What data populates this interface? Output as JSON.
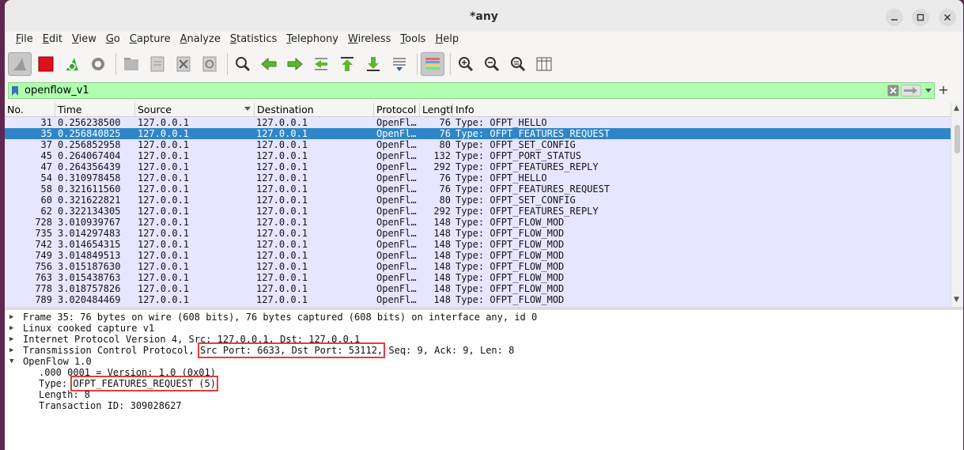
{
  "window": {
    "title": "*any"
  },
  "menu": [
    "File",
    "Edit",
    "View",
    "Go",
    "Capture",
    "Analyze",
    "Statistics",
    "Telephony",
    "Wireless",
    "Tools",
    "Help"
  ],
  "toolbar": {
    "icons": [
      "shark-fin-start-icon",
      "stop-capture-icon",
      "restart-capture-icon",
      "capture-options-icon",
      "open-file-icon",
      "save-file-icon",
      "close-file-icon",
      "reload-file-icon",
      "find-packet-icon",
      "go-back-icon",
      "go-forward-icon",
      "go-to-packet-icon",
      "first-packet-icon",
      "last-packet-icon",
      "auto-scroll-icon",
      "colorize-icon",
      "zoom-in-icon",
      "zoom-out-icon",
      "normal-size-icon",
      "resize-columns-icon"
    ]
  },
  "filter": {
    "value": "openflow_v1"
  },
  "columns": [
    "No.",
    "Time",
    "Source",
    "Destination",
    "Protocol",
    "Length",
    "Info"
  ],
  "packets": [
    {
      "no": "31",
      "time": "0.256238500",
      "src": "127.0.0.1",
      "dst": "127.0.0.1",
      "proto": "OpenFl…",
      "len": "76",
      "info": "Type: OFPT_HELLO"
    },
    {
      "no": "35",
      "time": "0.256840825",
      "src": "127.0.0.1",
      "dst": "127.0.0.1",
      "proto": "OpenFl…",
      "len": "76",
      "info": "Type: OFPT_FEATURES_REQUEST",
      "selected": true
    },
    {
      "no": "37",
      "time": "0.256852958",
      "src": "127.0.0.1",
      "dst": "127.0.0.1",
      "proto": "OpenFl…",
      "len": "80",
      "info": "Type: OFPT_SET_CONFIG"
    },
    {
      "no": "45",
      "time": "0.264067404",
      "src": "127.0.0.1",
      "dst": "127.0.0.1",
      "proto": "OpenFl…",
      "len": "132",
      "info": "Type: OFPT_PORT_STATUS"
    },
    {
      "no": "47",
      "time": "0.264356439",
      "src": "127.0.0.1",
      "dst": "127.0.0.1",
      "proto": "OpenFl…",
      "len": "292",
      "info": "Type: OFPT_FEATURES_REPLY"
    },
    {
      "no": "54",
      "time": "0.310978458",
      "src": "127.0.0.1",
      "dst": "127.0.0.1",
      "proto": "OpenFl…",
      "len": "76",
      "info": "Type: OFPT_HELLO"
    },
    {
      "no": "58",
      "time": "0.321611560",
      "src": "127.0.0.1",
      "dst": "127.0.0.1",
      "proto": "OpenFl…",
      "len": "76",
      "info": "Type: OFPT_FEATURES_REQUEST"
    },
    {
      "no": "60",
      "time": "0.321622821",
      "src": "127.0.0.1",
      "dst": "127.0.0.1",
      "proto": "OpenFl…",
      "len": "80",
      "info": "Type: OFPT_SET_CONFIG"
    },
    {
      "no": "62",
      "time": "0.322134305",
      "src": "127.0.0.1",
      "dst": "127.0.0.1",
      "proto": "OpenFl…",
      "len": "292",
      "info": "Type: OFPT_FEATURES_REPLY"
    },
    {
      "no": "728",
      "time": "3.010939767",
      "src": "127.0.0.1",
      "dst": "127.0.0.1",
      "proto": "OpenFl…",
      "len": "148",
      "info": "Type: OFPT_FLOW_MOD"
    },
    {
      "no": "735",
      "time": "3.014297483",
      "src": "127.0.0.1",
      "dst": "127.0.0.1",
      "proto": "OpenFl…",
      "len": "148",
      "info": "Type: OFPT_FLOW_MOD"
    },
    {
      "no": "742",
      "time": "3.014654315",
      "src": "127.0.0.1",
      "dst": "127.0.0.1",
      "proto": "OpenFl…",
      "len": "148",
      "info": "Type: OFPT_FLOW_MOD"
    },
    {
      "no": "749",
      "time": "3.014849513",
      "src": "127.0.0.1",
      "dst": "127.0.0.1",
      "proto": "OpenFl…",
      "len": "148",
      "info": "Type: OFPT_FLOW_MOD"
    },
    {
      "no": "756",
      "time": "3.015187630",
      "src": "127.0.0.1",
      "dst": "127.0.0.1",
      "proto": "OpenFl…",
      "len": "148",
      "info": "Type: OFPT_FLOW_MOD"
    },
    {
      "no": "763",
      "time": "3.015438763",
      "src": "127.0.0.1",
      "dst": "127.0.0.1",
      "proto": "OpenFl…",
      "len": "148",
      "info": "Type: OFPT_FLOW_MOD"
    },
    {
      "no": "778",
      "time": "3.018757826",
      "src": "127.0.0.1",
      "dst": "127.0.0.1",
      "proto": "OpenFl…",
      "len": "148",
      "info": "Type: OFPT_FLOW_MOD"
    },
    {
      "no": "789",
      "time": "3.020484469",
      "src": "127.0.0.1",
      "dst": "127.0.0.1",
      "proto": "OpenFl…",
      "len": "148",
      "info": "Type: OFPT_FLOW_MOD"
    }
  ],
  "details": {
    "frame": "Frame 35: 76 bytes on wire (608 bits), 76 bytes captured (608 bits) on interface any, id 0",
    "linux": "Linux cooked capture v1",
    "ip": "Internet Protocol Version 4, Src: 127.0.0.1, Dst: 127.0.0.1",
    "tcp_prefix": "Transmission Control Protocol, ",
    "tcp_ports": "Src Port: 6633, Dst Port: 53112,",
    "tcp_suffix": " Seq: 9, Ack: 9, Len: 8",
    "openflow": "OpenFlow 1.0",
    "version": ".000 0001 = Version: 1.0 (0x01)",
    "type_label": "Type: ",
    "type_value": "OFPT_FEATURES_REQUEST (5)",
    "length": "Length: 8",
    "xid": "Transaction ID: 309028627"
  },
  "colors": {
    "selected_row": "#2e86c8",
    "row_bg": "#e7e6ff",
    "filter_ok": "#afffaf",
    "highlight": "#e53b3b"
  }
}
